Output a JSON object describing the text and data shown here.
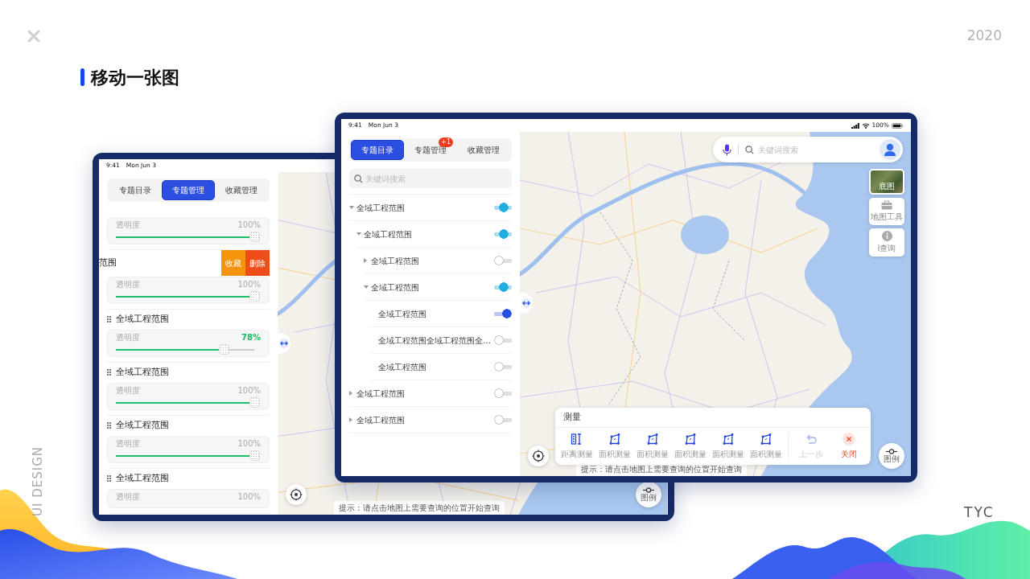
{
  "slide": {
    "year": "2020",
    "title": "移动一张图",
    "side_label": "UI DESIGN",
    "brand": "TYC"
  },
  "back_tablet": {
    "status_bar": {
      "time": "9:41",
      "date": "Mon Jun 3"
    },
    "tabs": [
      {
        "label": "专题目录",
        "selected": false
      },
      {
        "label": "专题管理",
        "selected": true
      },
      {
        "label": "收藏管理",
        "selected": false
      }
    ],
    "layers": [
      {
        "kind": "cut",
        "opacity_label": "透明度",
        "reading": "100%",
        "level": 1,
        "dragging": false
      },
      {
        "kind": "swiped",
        "title": "范围",
        "actions": [
          {
            "label": "收藏",
            "kind": "favorite"
          },
          {
            "label": "删除",
            "kind": "delete"
          }
        ],
        "opacity_label": "透明度",
        "reading": "100%",
        "level": 1,
        "dragging": false
      },
      {
        "kind": "normal",
        "title": "全域工程范围",
        "opacity_label": "透明度",
        "reading": "78%",
        "level": 0.78,
        "dragging": true
      },
      {
        "kind": "normal",
        "title": "全域工程范围",
        "opacity_label": "透明度",
        "reading": "100%",
        "level": 1,
        "dragging": false
      },
      {
        "kind": "normal",
        "title": "全域工程范围",
        "opacity_label": "透明度",
        "reading": "100%",
        "level": 1,
        "dragging": false
      },
      {
        "kind": "normal",
        "title": "全域工程范围",
        "opacity_label": "透明度",
        "reading": "100%",
        "dragging": false
      }
    ],
    "hint": "提示：请点击地图上需要查询的位置开始查询",
    "legend_label": "图例"
  },
  "front_tablet": {
    "status_bar": {
      "time": "9:41",
      "date": "Mon Jun 3",
      "battery": "100%"
    },
    "tabs": [
      {
        "label": "专题目录",
        "selected": true
      },
      {
        "label": "专题管理",
        "selected": false,
        "badge": "+1"
      },
      {
        "label": "收藏管理",
        "selected": false
      }
    ],
    "search": {
      "placeholder": "关键词搜索"
    },
    "tree": [
      {
        "label": "全域工程范围",
        "on": true,
        "expanded": true,
        "children": [
          {
            "label": "全域工程范围",
            "on": true,
            "expanded": true,
            "children": [
              {
                "label": "全域工程范围",
                "on": false,
                "expanded": false
              },
              {
                "label": "全域工程范围",
                "on": true,
                "expanded": true,
                "children": [
                  {
                    "label": "全域工程范围",
                    "on": true
                  },
                  {
                    "label": "全域工程范围全域工程范围全…",
                    "on": false
                  },
                  {
                    "label": "全域工程范围",
                    "on": false
                  }
                ]
              }
            ]
          }
        ]
      },
      {
        "label": "全域工程范围",
        "on": false,
        "expanded": false
      },
      {
        "label": "全域工程范围",
        "on": false,
        "expanded": false
      }
    ],
    "map_search": {
      "placeholder": "关键词搜索"
    },
    "map_tools": [
      {
        "label": "底图",
        "kind": "basemap"
      },
      {
        "label": "地图工具",
        "kind": "toolbox"
      },
      {
        "label": "i查询",
        "kind": "query"
      }
    ],
    "measure": {
      "title": "测量",
      "tools": [
        {
          "label": "距离测量",
          "kind": "distance"
        },
        {
          "label": "面积测量",
          "kind": "area"
        },
        {
          "label": "面积测量",
          "kind": "area"
        },
        {
          "label": "面积测量",
          "kind": "area"
        },
        {
          "label": "面积测量",
          "kind": "area"
        },
        {
          "label": "面积测量",
          "kind": "area"
        }
      ],
      "actions": [
        {
          "label": "上一步",
          "kind": "undo",
          "disabled": true
        },
        {
          "label": "关闭",
          "kind": "close",
          "disabled": false
        }
      ]
    },
    "hint": "提示：请点击地图上需要查询的位置开始查询",
    "legend_label": "图例"
  }
}
